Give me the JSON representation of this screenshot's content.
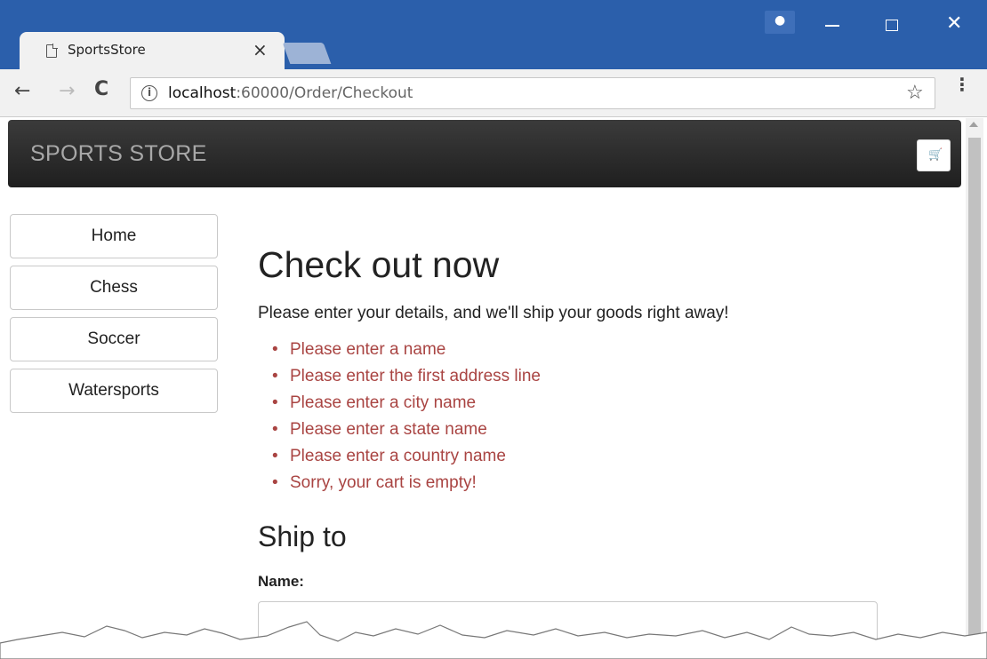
{
  "browser": {
    "tab_title": "SportsStore",
    "tab_close": "×",
    "window_controls": {
      "minimize": "–",
      "maximize": "□",
      "close": "✕"
    },
    "profile_icon": "person-icon",
    "url_host": "localhost",
    "url_rest": ":60000/Order/Checkout",
    "info_glyph": "i",
    "back_glyph": "←",
    "forward_glyph": "→",
    "reload_glyph": "C",
    "star_glyph": "☆",
    "menu_glyph": "⋮"
  },
  "navbar": {
    "brand": "SPORTS STORE",
    "cart_icon": "cart-icon"
  },
  "sidebar": {
    "items": [
      {
        "label": "Home"
      },
      {
        "label": "Chess"
      },
      {
        "label": "Soccer"
      },
      {
        "label": "Watersports"
      }
    ]
  },
  "main": {
    "title": "Check out now",
    "intro": "Please enter your details, and we'll ship your goods right away!",
    "errors": [
      "Please enter a name",
      "Please enter the first address line",
      "Please enter a city name",
      "Please enter a state name",
      "Please enter a country name",
      "Sorry, your cart is empty!"
    ],
    "ship_heading": "Ship to",
    "name_label": "Name:",
    "name_value": ""
  },
  "colors": {
    "titlebar": "#2b5fab",
    "navbar": "#222222",
    "error_text": "#a94442"
  }
}
